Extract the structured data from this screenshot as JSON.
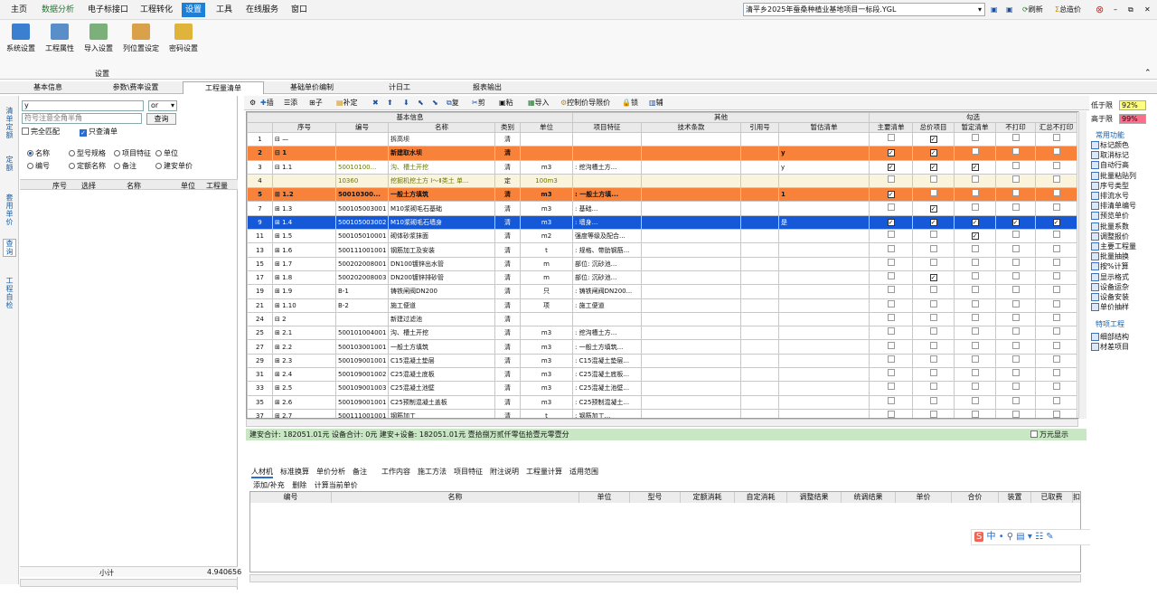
{
  "menu": [
    "主页",
    "数据分析",
    "电子标接口",
    "工程转化",
    "设置",
    "工具",
    "在线服务",
    "窗口"
  ],
  "project_path": "清平乡2025年蚕桑种植业基地项目一标段.YGL",
  "titlebar": {
    "save": "",
    "refresh": "刷新",
    "total": "总造价"
  },
  "ribbon": {
    "group_label": "设置",
    "buttons": [
      "系统设置",
      "工程属性",
      "导入设置",
      "列位置设定",
      "密码设置"
    ]
  },
  "tabs": [
    "基本信息",
    "参数\\费率设置",
    "工程量清单",
    "基础单价编制",
    "计日工",
    "报表输出"
  ],
  "left_vtabs": [
    "清单定额",
    "定额",
    "套用单价",
    "查询",
    "工程自检"
  ],
  "left": {
    "search_value": "y",
    "search_mode": "or",
    "hint": "符号注意全角半角",
    "query": "查询",
    "exact": "完全匹配",
    "only_list": "只查清单",
    "radios": [
      "名称",
      "型号规格",
      "项目特征",
      "单位",
      "编号",
      "定额名称",
      "备注",
      "建安单价"
    ],
    "cols": [
      "序号",
      "选择",
      "名称",
      "单位",
      "工程量"
    ],
    "subtotal_label": "小计",
    "subtotal_value": "4.940656"
  },
  "toolbar": [
    "插",
    "添",
    "子",
    "补定",
    "",
    "",
    "",
    "",
    "复",
    "剪",
    "粘",
    "导入",
    "控制价导限价",
    "锁",
    "辅"
  ],
  "grid": {
    "group_headers": {
      "basic": "基本信息",
      "other": "其他",
      "check": "勾选"
    },
    "cols": [
      "序号",
      "编号",
      "名称",
      "类别",
      "单位",
      "项目特征",
      "技术条款",
      "引用号",
      "暂估清单",
      "主要清单",
      "总价项目",
      "暂定清单",
      "不打印",
      "汇总不打印"
    ],
    "rows": [
      {
        "n": "1",
        "t": "⊟ —",
        "code": "",
        "name": "拆高坝",
        "cat": "清",
        "unit": "",
        "feat": "",
        "ref": "",
        "zg": "",
        "cb": [
          0,
          1,
          0,
          0,
          0
        ],
        "style": ""
      },
      {
        "n": "2",
        "t": "⊟ 1",
        "code": "",
        "name": "新建取水坝",
        "cat": "清",
        "unit": "",
        "feat": "",
        "ref": "y",
        "zg": "",
        "cb": [
          1,
          1,
          0,
          0,
          0
        ],
        "style": "orange"
      },
      {
        "n": "3",
        "t": "⊟ 1.1",
        "code": "50010100...",
        "name": "沟、槽土开挖",
        "cat": "清",
        "unit": "m3",
        "feat": ": 挖沟槽土方...",
        "ref": "y",
        "zg": "",
        "cb": [
          1,
          1,
          1,
          0,
          0
        ],
        "style": "greentext"
      },
      {
        "n": "4",
        "t": "",
        "code": "10360",
        "name": "挖掘机挖土方 Ⅰ～Ⅱ类土 单...",
        "cat": "定",
        "unit": "100m3",
        "feat": "",
        "ref": "",
        "zg": "",
        "cb": [
          0,
          0,
          0,
          0,
          0
        ],
        "style": "lightrow"
      },
      {
        "n": "5",
        "t": "⊞ 1.2",
        "code": "50010300...",
        "name": "一般土方填筑",
        "cat": "清",
        "unit": "m3",
        "feat": ": 一般土方填...",
        "ref": "1",
        "zg": "",
        "cb": [
          1,
          0,
          0,
          0,
          0
        ],
        "style": "orange"
      },
      {
        "n": "7",
        "t": "⊞ 1.3",
        "code": "500105003001",
        "name": "M10浆砌毛石基础",
        "cat": "清",
        "unit": "m3",
        "feat": ": 基础...",
        "ref": "",
        "zg": "",
        "cb": [
          0,
          1,
          0,
          0,
          0
        ],
        "style": ""
      },
      {
        "n": "9",
        "t": "⊞ 1.4",
        "code": "500105003002",
        "name": "M10浆砌毛石墙身",
        "cat": "清",
        "unit": "m3",
        "feat": ": 墙身...",
        "ref": "是",
        "zg": "",
        "cb": [
          1,
          1,
          1,
          1,
          1
        ],
        "style": "selrow"
      },
      {
        "n": "11",
        "t": "⊞ 1.5",
        "code": "500105010001",
        "name": "砌体砂浆抹面",
        "cat": "清",
        "unit": "m2",
        "feat": "强度等级及配合...",
        "ref": "",
        "zg": "",
        "cb": [
          0,
          0,
          1,
          0,
          0
        ],
        "style": ""
      },
      {
        "n": "13",
        "t": "⊞ 1.6",
        "code": "500111001001",
        "name": "钢筋加工及安装",
        "cat": "清",
        "unit": "t",
        "feat": ": 规格、带肋钢筋...",
        "ref": "",
        "zg": "",
        "cb": [
          0,
          0,
          0,
          0,
          0
        ],
        "style": ""
      },
      {
        "n": "15",
        "t": "⊞ 1.7",
        "code": "500202008001",
        "name": "DN100镀锌出水管",
        "cat": "清",
        "unit": "m",
        "feat": "部位: 沉砂池...",
        "ref": "",
        "zg": "",
        "cb": [
          0,
          0,
          0,
          0,
          0
        ],
        "style": ""
      },
      {
        "n": "17",
        "t": "⊞ 1.8",
        "code": "500202008003",
        "name": "DN200镀锌排砂管",
        "cat": "清",
        "unit": "m",
        "feat": "部位: 沉砂池...",
        "ref": "",
        "zg": "",
        "cb": [
          0,
          1,
          0,
          0,
          0
        ],
        "style": ""
      },
      {
        "n": "19",
        "t": "⊞ 1.9",
        "code": "B-1",
        "name": "铸铁闸阀DN200",
        "cat": "清",
        "unit": "只",
        "feat": ": 铸铁闸阀DN200...",
        "ref": "",
        "zg": "",
        "cb": [
          0,
          0,
          0,
          0,
          0
        ],
        "style": ""
      },
      {
        "n": "21",
        "t": "⊞ 1.10",
        "code": "B-2",
        "name": "施工便道",
        "cat": "清",
        "unit": "项",
        "feat": ": 施工便道",
        "ref": "",
        "zg": "",
        "cb": [
          0,
          0,
          0,
          0,
          0
        ],
        "style": ""
      },
      {
        "n": "24",
        "t": "⊟ 2",
        "code": "",
        "name": "新建过滤池",
        "cat": "清",
        "unit": "",
        "feat": "",
        "ref": "",
        "zg": "",
        "cb": [
          0,
          0,
          0,
          0,
          0
        ],
        "style": ""
      },
      {
        "n": "25",
        "t": "⊞ 2.1",
        "code": "500101004001",
        "name": "沟、槽土开挖",
        "cat": "清",
        "unit": "m3",
        "feat": ": 挖沟槽土方...",
        "ref": "",
        "zg": "",
        "cb": [
          0,
          0,
          0,
          0,
          0
        ],
        "style": ""
      },
      {
        "n": "27",
        "t": "⊞ 2.2",
        "code": "500103001001",
        "name": "一般土方填筑",
        "cat": "清",
        "unit": "m3",
        "feat": ": 一般土方填筑...",
        "ref": "",
        "zg": "",
        "cb": [
          0,
          0,
          0,
          0,
          0
        ],
        "style": ""
      },
      {
        "n": "29",
        "t": "⊞ 2.3",
        "code": "500109001001",
        "name": "C15混凝土垫层",
        "cat": "清",
        "unit": "m3",
        "feat": ": C15混凝土垫层...",
        "ref": "",
        "zg": "",
        "cb": [
          0,
          0,
          0,
          0,
          0
        ],
        "style": ""
      },
      {
        "n": "31",
        "t": "⊞ 2.4",
        "code": "500109001002",
        "name": "C25混凝土底板",
        "cat": "清",
        "unit": "m3",
        "feat": ": C25混凝土底板...",
        "ref": "",
        "zg": "",
        "cb": [
          0,
          0,
          0,
          0,
          0
        ],
        "style": ""
      },
      {
        "n": "33",
        "t": "⊞ 2.5",
        "code": "500109001003",
        "name": "C25混凝土池壁",
        "cat": "清",
        "unit": "m3",
        "feat": ": C25混凝土池壁...",
        "ref": "",
        "zg": "",
        "cb": [
          0,
          0,
          0,
          0,
          0
        ],
        "style": ""
      },
      {
        "n": "35",
        "t": "⊞ 2.6",
        "code": "500109001001",
        "name": "C25预制混凝土盖板",
        "cat": "清",
        "unit": "m3",
        "feat": ": C25预制混凝土...",
        "ref": "",
        "zg": "",
        "cb": [
          0,
          0,
          0,
          0,
          0
        ],
        "style": ""
      },
      {
        "n": "37",
        "t": "⊞ 2.7",
        "code": "500111001001",
        "name": "钢筋加工",
        "cat": "清",
        "unit": "t",
        "feat": ": 钢筋加工...",
        "ref": "",
        "zg": "",
        "cb": [
          0,
          0,
          0,
          0,
          0
        ],
        "style": ""
      }
    ]
  },
  "status": "建安合计: 182051.01元  设备合计: 0元  建安+设备: 182051.01元   壹拾捌万贰仟零伍拾壹元零壹分",
  "wan": "万元显示",
  "bottom": {
    "tabs": [
      "人材机",
      "标准换算",
      "单价分析",
      "备注",
      "工作内容",
      "施工方法",
      "项目特征",
      "附注说明",
      "工程量计算",
      "适用范围"
    ],
    "actions": [
      "添加/补充",
      "删除",
      "计算当前单价"
    ],
    "cols": [
      "编号",
      "名称",
      "单位",
      "型号",
      "定额消耗",
      "自定消耗",
      "调整结果",
      "统调结果",
      "单价",
      "合价",
      "装置",
      "已取费",
      "扣"
    ]
  },
  "right": {
    "low_label": "低于限",
    "low_val": "92%",
    "high_label": "高于限",
    "high_val": "99%",
    "common": "常用功能",
    "items": [
      "标记颜色",
      "取消标记",
      "自动行高",
      "批量粘贴列",
      "序号类型",
      "排流水号",
      "排清单编号",
      "预览单价",
      "批量系数",
      "调整报价",
      "主要工程量",
      "批量抽换",
      "按%计算",
      "显示格式",
      "设备运杂",
      "设备安装",
      "单价抽样"
    ],
    "special": "特项工程",
    "special_items": [
      "细部结构",
      "材差项目"
    ]
  },
  "colors": {
    "accent": "#1e7fd6",
    "orange": "#f8823a",
    "selected": "#1559d8",
    "status": "#c9e7c5"
  }
}
